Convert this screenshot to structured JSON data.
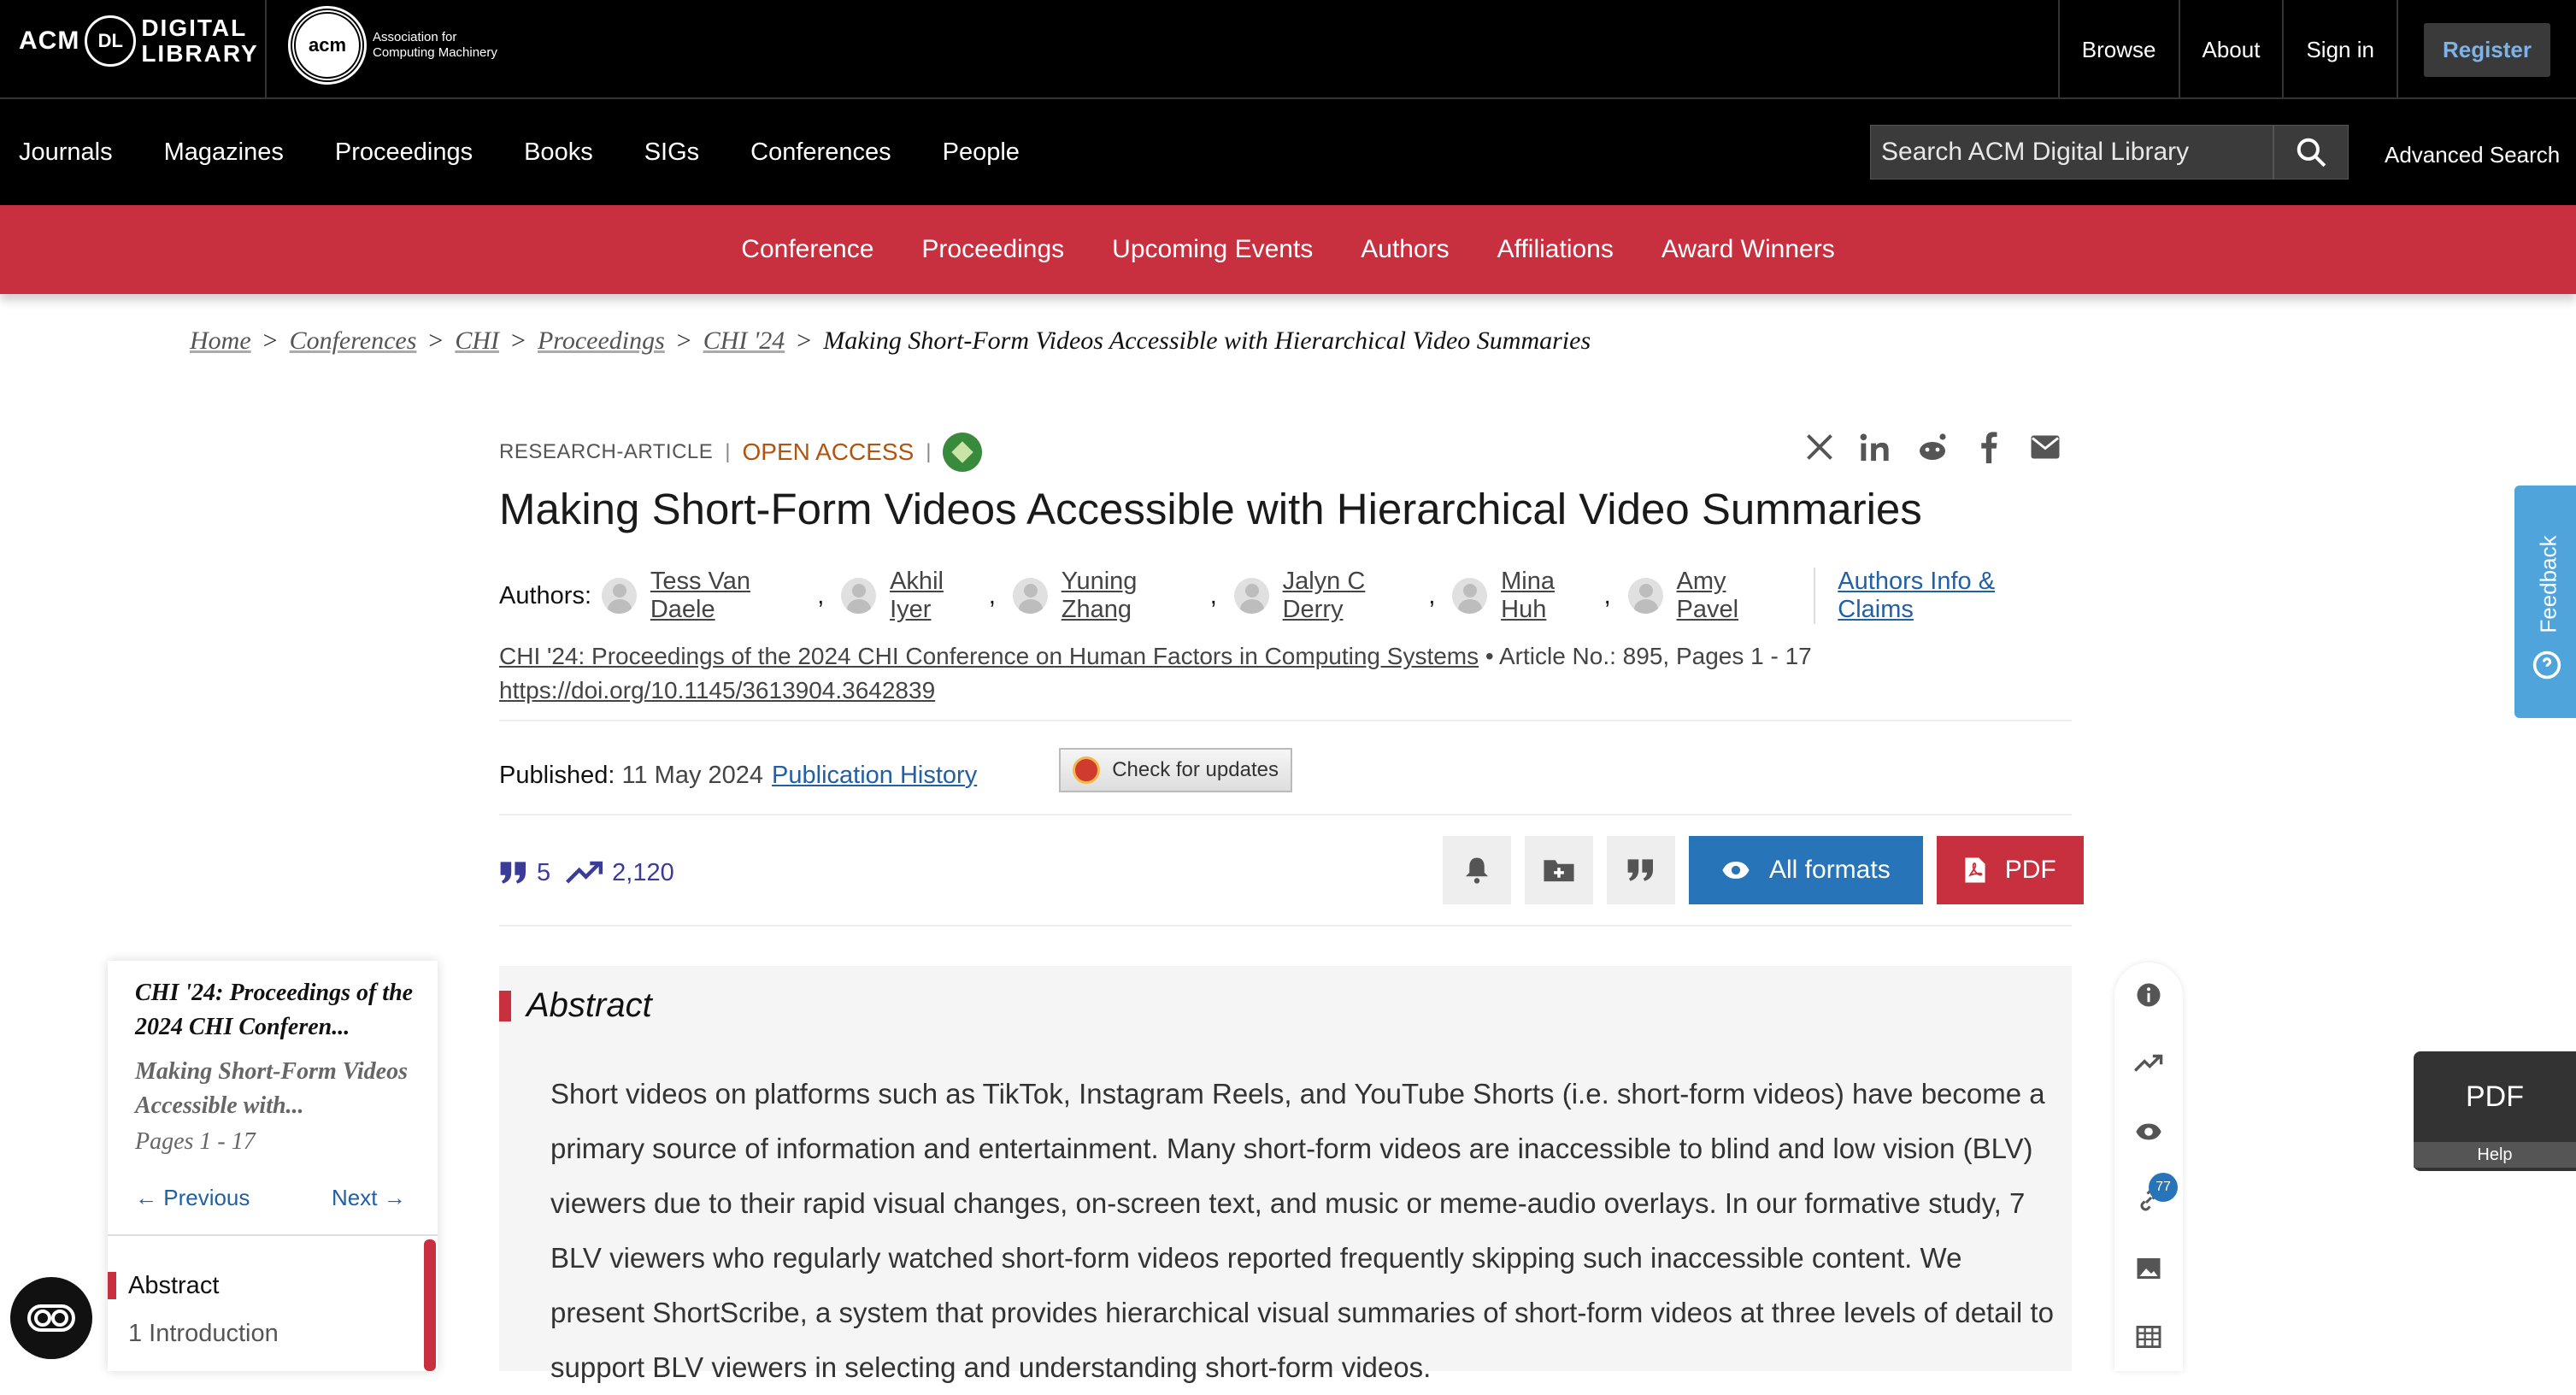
{
  "header": {
    "dl_logo": {
      "acm": "ACM",
      "badge": "DL",
      "line1": "DIGITAL",
      "line2": "LIBRARY"
    },
    "acm_logo": {
      "mark": "acm",
      "line1": "Association for",
      "line2": "Computing Machinery"
    },
    "links": [
      "Browse",
      "About",
      "Sign in"
    ],
    "register": "Register"
  },
  "nav": {
    "items": [
      "Journals",
      "Magazines",
      "Proceedings",
      "Books",
      "SIGs",
      "Conferences",
      "People"
    ],
    "search_placeholder": "Search ACM Digital Library",
    "advanced": "Advanced Search"
  },
  "conf_nav": {
    "items": [
      "Conference",
      "Proceedings",
      "Upcoming Events",
      "Authors",
      "Affiliations",
      "Award Winners"
    ]
  },
  "breadcrumb": {
    "items": [
      "Home",
      "Conferences",
      "CHI",
      "Proceedings",
      "CHI '24"
    ],
    "current": "Making Short-Form Videos Accessible with Hierarchical Video Summaries"
  },
  "article": {
    "type": "RESEARCH-ARTICLE",
    "access": "OPEN ACCESS",
    "title": "Making Short-Form Videos Accessible with Hierarchical Video Summaries",
    "authors_label": "Authors",
    "authors": [
      "Tess Van Daele",
      "Akhil Iyer",
      "Yuning Zhang",
      "Jalyn C Derry",
      "Mina Huh",
      "Amy Pavel"
    ],
    "authors_info": "Authors Info & Claims",
    "venue": "CHI '24: Proceedings of the 2024 CHI Conference on Human Factors in Computing Systems",
    "article_no": "Article No.: 895, Pages 1 - 17",
    "doi": "https://doi.org/10.1145/3613904.3642839",
    "published_label": "Published",
    "published_date": "11 May 2024",
    "pub_history": "Publication History",
    "check_updates": "Check for updates",
    "citations": "5",
    "downloads": "2,120",
    "all_formats": "All formats",
    "pdf": "PDF"
  },
  "abstract": {
    "heading": "Abstract",
    "text": "Short videos on platforms such as TikTok, Instagram Reels, and YouTube Shorts (i.e. short-form videos) have become a primary source of information and entertainment. Many short-form videos are inaccessible to blind and low vision (BLV) viewers due to their rapid visual changes, on-screen text, and music or meme-audio overlays. In our formative study, 7 BLV viewers who regularly watched short-form videos reported frequently skipping such inaccessible content. We present  ShortScribe, a system that provides hierarchical visual summaries of short-form videos at three levels of detail to support BLV viewers in selecting and understanding short-form videos."
  },
  "toc": {
    "proceedings": "CHI '24: Proceedings of the 2024 CHI Conferen...",
    "article": "Making Short-Form Videos Accessible with...",
    "pages": "Pages 1 - 17",
    "prev": "Previous",
    "next": "Next",
    "sections": [
      "Abstract",
      "1 Introduction"
    ]
  },
  "rail": {
    "link_count": "77"
  },
  "feedback": "Feedback",
  "pdf_help": {
    "label": "PDF",
    "help": "Help"
  },
  "colors": {
    "brand_red": "#c9303f",
    "link_blue": "#2160a5",
    "button_blue": "#2874b8",
    "open_access": "#b4530e"
  }
}
